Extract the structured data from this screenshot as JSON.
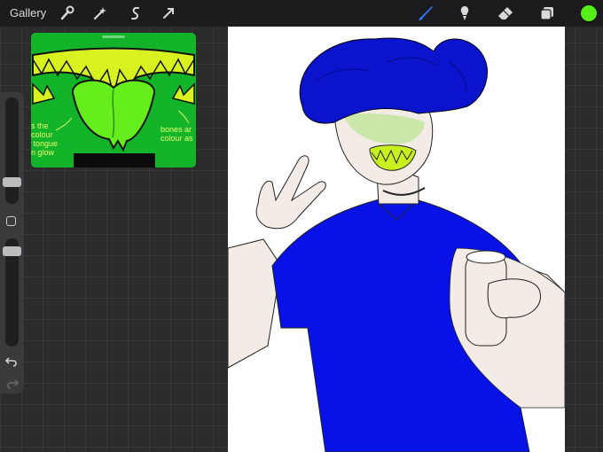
{
  "toolbar": {
    "gallery_label": "Gallery",
    "left_icons": [
      "wrench-icon",
      "magic-wand-icon",
      "selection-icon",
      "transform-arrow-icon"
    ],
    "right_icons": [
      "brush-icon",
      "smudge-icon",
      "eraser-icon",
      "layers-icon"
    ],
    "current_color": "#54ef16",
    "brush_active_color": "#2f7bf6"
  },
  "sidebar": {
    "brush_size_level": 0.5,
    "opacity_level": 0.5
  },
  "reference": {
    "note_left": "s the\ncolour\n tongue\nn glow",
    "note_right": "bones ar\ncolour as",
    "bg_color": "#13b32a",
    "tongue_color": "#66ee1c",
    "teeth_color": "#d8f21f"
  },
  "canvas_art": {
    "hair_color": "#0a14cc",
    "shirt_color": "#0812e6",
    "skin_color": "#f2ebe6"
  }
}
